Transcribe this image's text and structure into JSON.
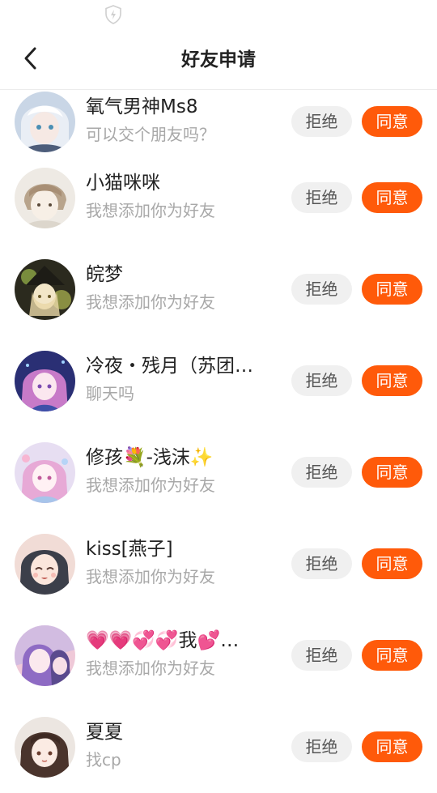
{
  "header": {
    "title": "好友申请"
  },
  "requests": [
    {
      "name": "氧气男神Ms8",
      "message": "可以交个朋友吗？",
      "reject_label": "拒绝",
      "accept_label": "同意"
    },
    {
      "name": "小猫咪咪",
      "message": "我想添加你为好友",
      "reject_label": "拒绝",
      "accept_label": "同意"
    },
    {
      "name": "皖梦",
      "message": "我想添加你为好友",
      "reject_label": "拒绝",
      "accept_label": "同意"
    },
    {
      "name": "冷夜・残月（苏团…",
      "message": "聊天吗",
      "reject_label": "拒绝",
      "accept_label": "同意"
    },
    {
      "name": "修孩💐-浅沫✨",
      "message": "我想添加你为好友",
      "reject_label": "拒绝",
      "accept_label": "同意"
    },
    {
      "name": "kiss[燕子]",
      "message": "我想添加你为好友",
      "reject_label": "拒绝",
      "accept_label": "同意"
    },
    {
      "name": "💗💗💞💞我💕…",
      "message": "我想添加你为好友",
      "reject_label": "拒绝",
      "accept_label": "同意"
    },
    {
      "name": "夏夏",
      "message": "找cp",
      "reject_label": "拒绝",
      "accept_label": "同意"
    }
  ],
  "colors": {
    "accent": "#ff5a0a",
    "reject_bg": "#f0f0f0",
    "secondary_text": "#a8a8a8"
  }
}
